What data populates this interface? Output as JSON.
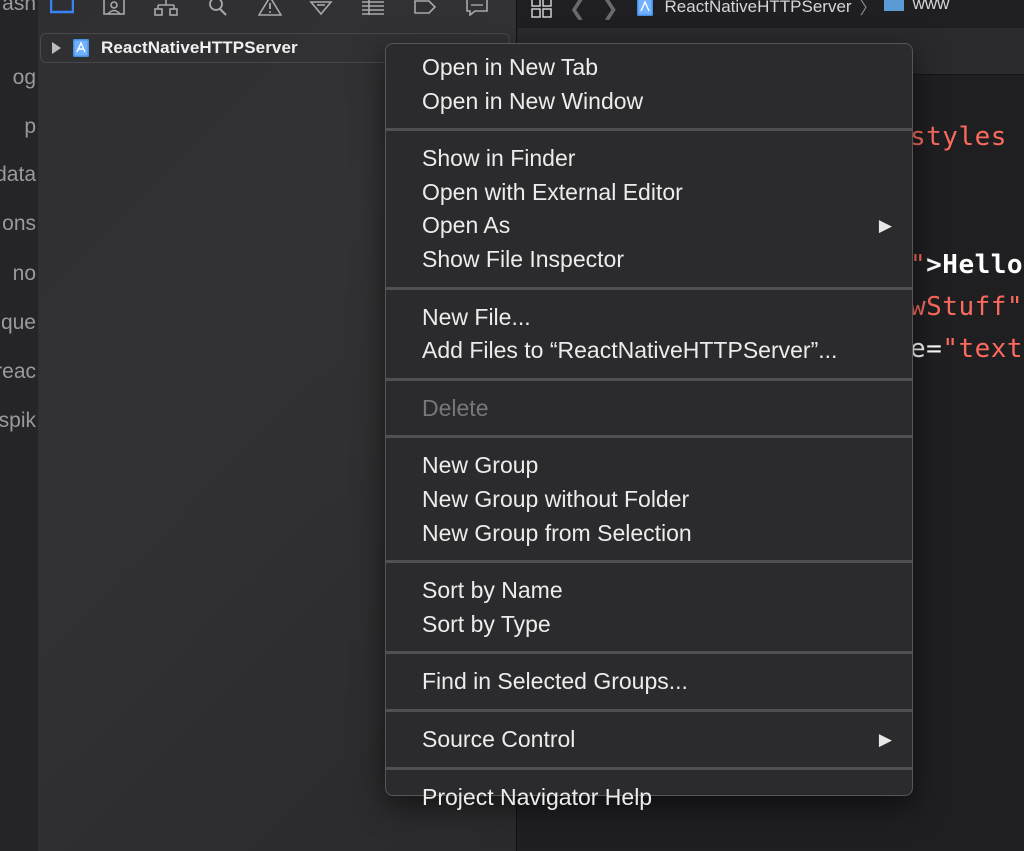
{
  "left_column": {
    "fragments": [
      "ash",
      "og",
      "p",
      "data",
      "ons",
      "no",
      "que",
      "reac",
      "spik"
    ]
  },
  "navigator": {
    "toolbar_icons": [
      "project-navigator-icon",
      "source-control-icon",
      "symbol-navigator-icon",
      "find-icon",
      "issue-icon",
      "test-icon",
      "debug-icon",
      "breakpoint-icon",
      "report-icon"
    ],
    "project_name": "ReactNativeHTTPServer"
  },
  "editor": {
    "jumpbar": {
      "project": "ReactNativeHTTPServer",
      "folder": "www"
    },
    "code_fragments": [
      "styles",
      "\">Hello",
      "wStuff\"",
      "e=\"text"
    ]
  },
  "context_menu": {
    "groups": [
      [
        "Open in New Tab",
        "Open in New Window"
      ],
      [
        "Show in Finder",
        "Open with External Editor",
        "Open As",
        "Show File Inspector"
      ],
      [
        "New File...",
        "Add Files to “ReactNativeHTTPServer”..."
      ],
      [
        "Delete"
      ],
      [
        "New Group",
        "New Group without Folder",
        "New Group from Selection"
      ],
      [
        "Sort by Name",
        "Sort by Type"
      ],
      [
        "Find in Selected Groups..."
      ],
      [
        "Source Control"
      ],
      [
        "Project Navigator Help"
      ]
    ],
    "submenu_arrow": "▶",
    "disabled_items": [
      "Delete"
    ]
  },
  "colors": {
    "code_red": "#fc6a5d",
    "code_white": "#ffffff",
    "selection_blue": "#3b82f6"
  }
}
